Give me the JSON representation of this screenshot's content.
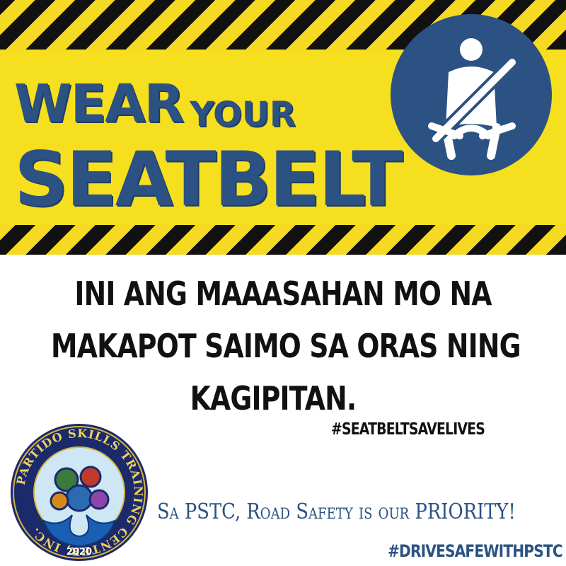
{
  "colors": {
    "brand_blue": "#2b5283",
    "hazard_yellow": "#f6df1f",
    "hazard_black": "#111111"
  },
  "headline": {
    "line1": "WEAR",
    "line1_small": "YOUR",
    "line2": "SEATBELT"
  },
  "badge_icon": "seatbelt-icon",
  "message": {
    "line1": "INI ANG MAAASAHAN MO NA",
    "line2": "MAKAPOT SAIMO SA ORAS NING",
    "line3": "KAGIPITAN."
  },
  "hashtag_primary": "#SEATBELTSAVELIVES",
  "tagline": "Sa PSTC, Road Safety is our PRIORITY!",
  "hashtag_secondary": "#DRIVESAFEWITHPSTC",
  "logo": {
    "ring_text": "PARTIDO SKILLS TRAINING CENTER, INC.",
    "year": "2020"
  }
}
